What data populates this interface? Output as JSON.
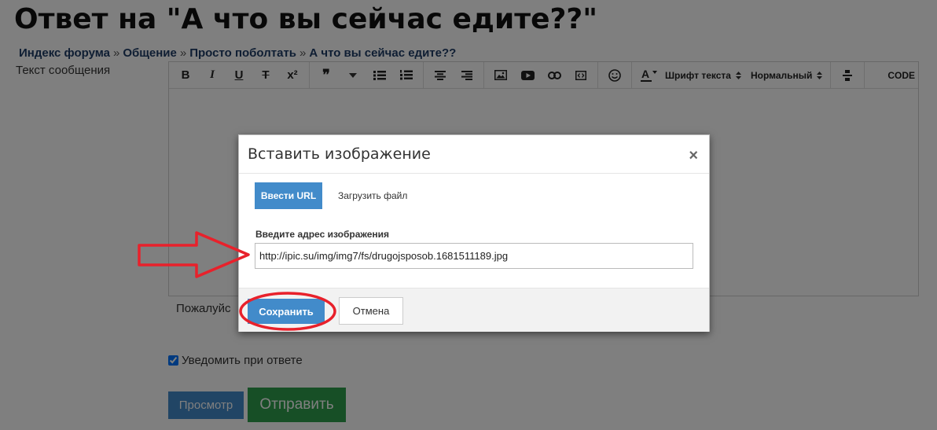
{
  "page": {
    "title": "Ответ на \"А что вы сейчас едите??\"",
    "breadcrumb": [
      "Индекс форума",
      "Общение",
      "Просто поболтать",
      "А что вы сейчас едите??"
    ],
    "breadcrumb_sep": "»",
    "message_label": "Текст сообщения",
    "below_editor_text": "Пожалуйс",
    "notify_label": "Уведомить при ответе",
    "notify_checked": true,
    "preview_button": "Просмотр",
    "send_button": "Отправить"
  },
  "toolbar": {
    "bold": "B",
    "italic": "I",
    "underline": "U",
    "strike": "T",
    "superscript": "x²",
    "quote": "❞",
    "font_name": "Шрифт текста",
    "font_size": "Нормальный",
    "code": "CODE"
  },
  "modal": {
    "title": "Вставить изображение",
    "close": "×",
    "tab_url": "Ввести URL",
    "tab_upload": "Загрузить файл",
    "field_label": "Введите адрес изображения",
    "url_value": "http://ipic.su/img/img7/fs/drugojsposob.1681511189.jpg",
    "save_button": "Сохранить",
    "cancel_button": "Отмена"
  },
  "colors": {
    "primary": "#428bca",
    "success": "#2e9e4d",
    "annotation": "#e8212b"
  }
}
